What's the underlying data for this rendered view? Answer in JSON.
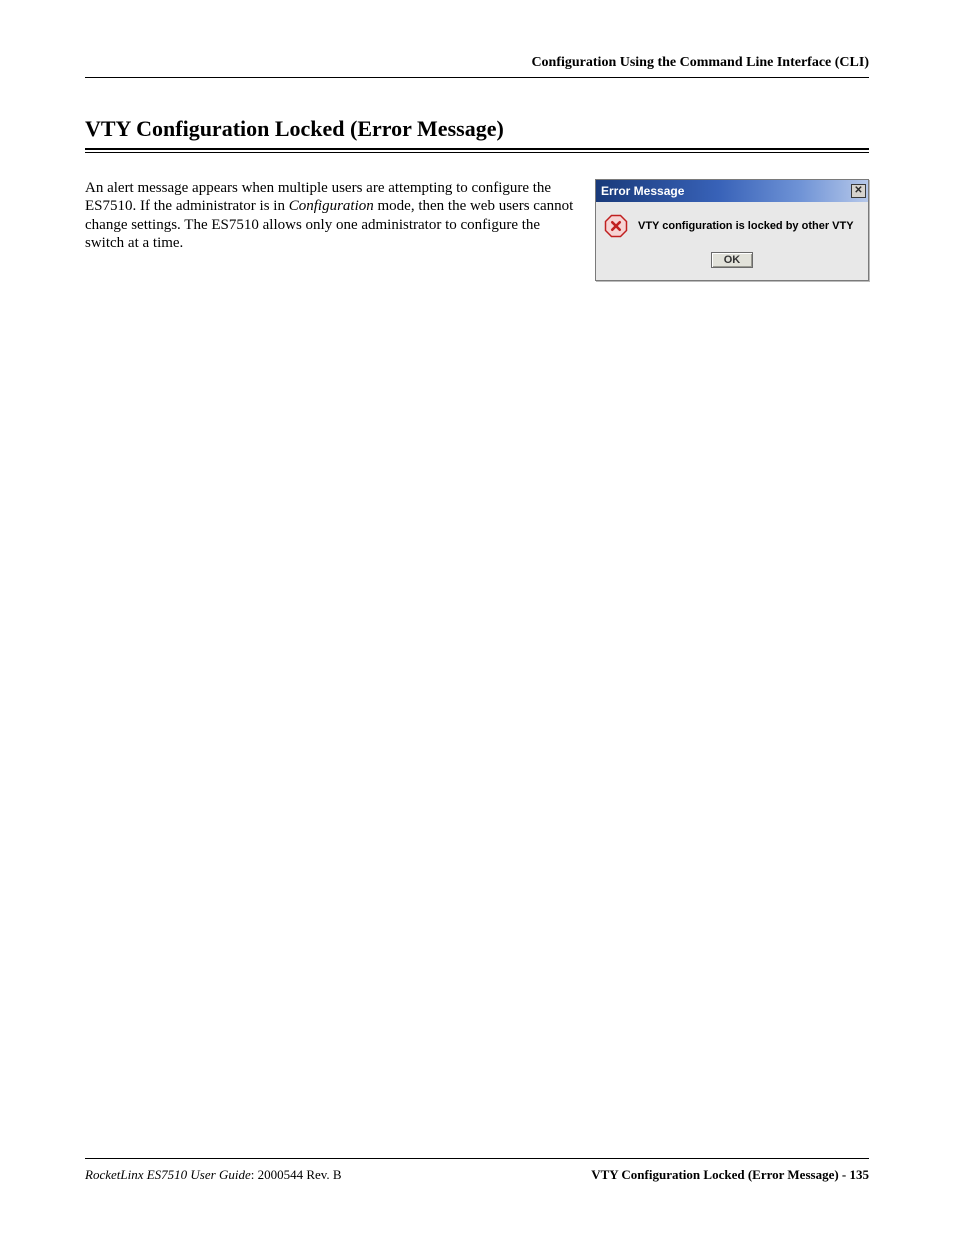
{
  "header": {
    "right": "Configuration Using the Command Line Interface (CLI)"
  },
  "section": {
    "title": "VTY Configuration Locked (Error Message)"
  },
  "body": {
    "p1a": "An alert message appears when multiple users are attempting to configure the ES7510. If the administrator is in ",
    "p1_em": "Configuration",
    "p1b": " mode, then the web users cannot change settings. The ES7510 allows only one administrator to configure the switch at a time."
  },
  "dialog": {
    "title": "Error Message",
    "message": "VTY configuration is locked by other VTY",
    "ok": "OK",
    "close_glyph": "✕"
  },
  "footer": {
    "left_em": "RocketLinx ES7510  User Guide",
    "left_plain": ": 2000544 Rev. B",
    "right": "VTY Configuration Locked (Error Message) - 135"
  }
}
